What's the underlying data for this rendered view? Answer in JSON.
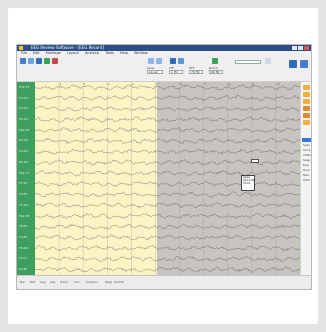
{
  "window": {
    "title": "EEG Review Software - [EEG Record]"
  },
  "menu": [
    "File",
    "Edit",
    "Montage",
    "Layout",
    "Analysis",
    "Tools",
    "Help",
    "Window"
  ],
  "toolbar": {
    "fields": [
      {
        "label": "Sens",
        "value": "10 µV"
      },
      {
        "label": "LFF",
        "value": "1 Hz"
      },
      {
        "label": "HFF",
        "value": "70 Hz"
      },
      {
        "label": "Notch",
        "value": "60 Hz"
      }
    ]
  },
  "channels": [
    "Fp1-F3",
    "F3-C3",
    "C3-P3",
    "P3-O1",
    "Fp2-F4",
    "F4-C4",
    "C4-P4",
    "P4-O2",
    "Fp1-F7",
    "F7-T3",
    "T3-T5",
    "T5-O1",
    "Fp2-F8",
    "F8-T4",
    "T4-T6",
    "T6-O2",
    "Fz-Cz",
    "Cz-Pz"
  ],
  "time_marks": [
    "1",
    "2",
    "3",
    "4",
    "5",
    "6",
    "7",
    "8",
    "9",
    "10"
  ],
  "right_panel": {
    "items": [
      "Spike",
      "Sharp",
      "Artifact",
      "Sleep",
      "Eyes",
      "Move",
      "Note",
      "Other"
    ]
  },
  "tooltip": {
    "lines": [
      "Spike",
      "00:12:45",
      "F4-C4"
    ]
  },
  "status": {
    "tabs": [
      "Bip",
      "Ref",
      "Avg",
      "Lap",
      "Trans",
      "Circ",
      "Custom",
      "Page 12/340"
    ]
  }
}
